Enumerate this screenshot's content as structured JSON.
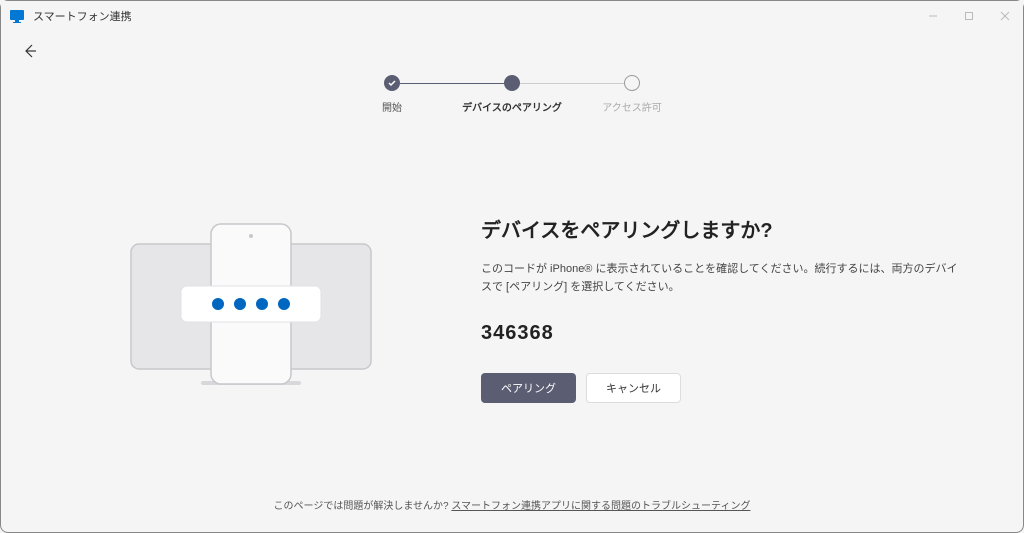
{
  "window": {
    "title": "スマートフォン連携"
  },
  "stepper": {
    "steps": [
      {
        "label": "開始"
      },
      {
        "label": "デバイスのペアリング"
      },
      {
        "label": "アクセス許可"
      }
    ]
  },
  "main": {
    "heading": "デバイスをペアリングしますか?",
    "body": "このコードが iPhone® に表示されていることを確認してください。続行するには、両方のデバイスで [ペアリング] を選択してください。",
    "code": "346368"
  },
  "buttons": {
    "pair": "ペアリング",
    "cancel": "キャンセル"
  },
  "footer": {
    "prefix": "このページでは問題が解決しませんか? ",
    "link": "スマートフォン連携アプリに関する問題のトラブルシューティング"
  }
}
